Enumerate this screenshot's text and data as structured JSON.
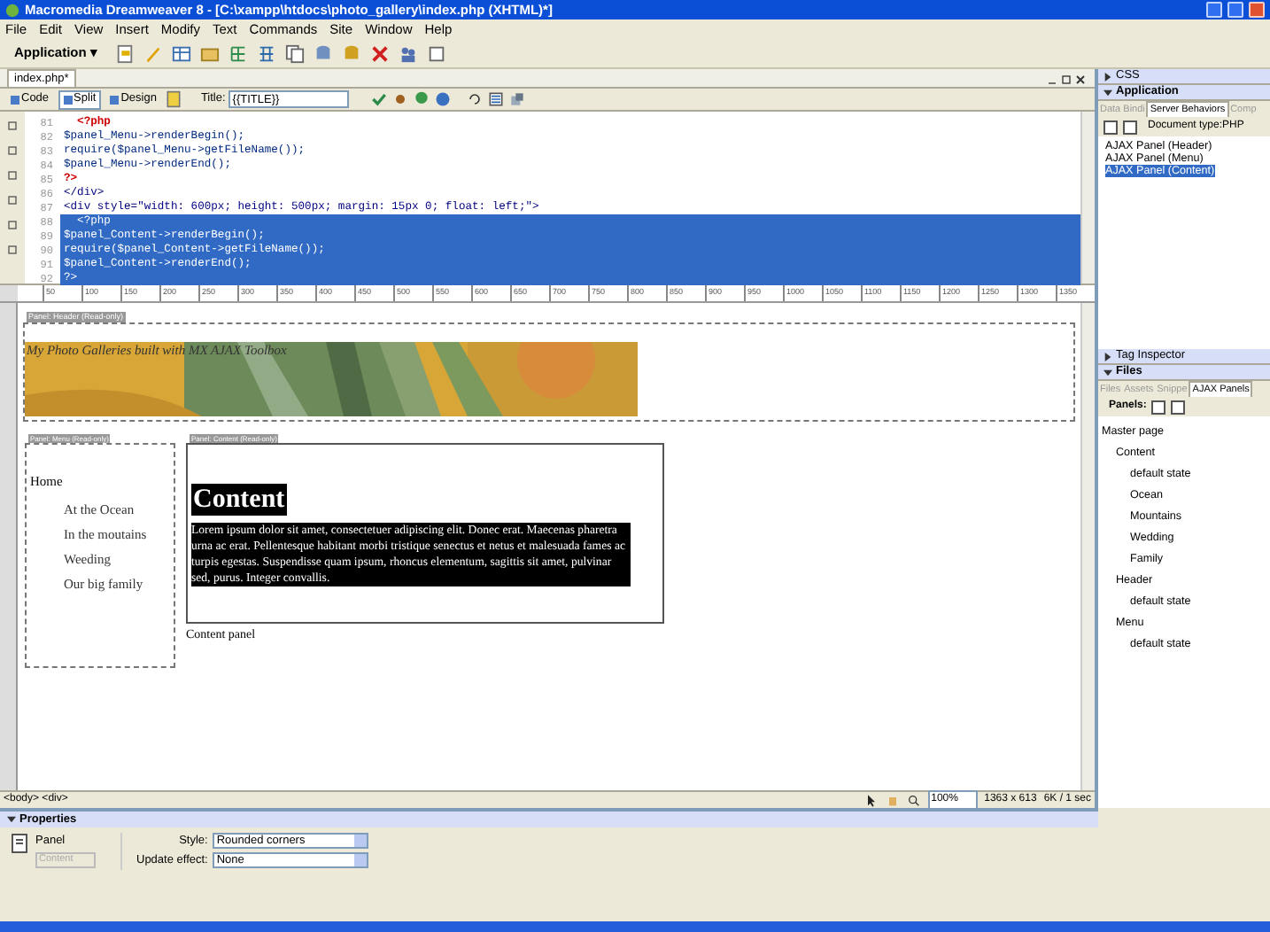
{
  "window": {
    "title": "Macromedia Dreamweaver 8 - [C:\\xampp\\htdocs\\photo_gallery\\index.php (XHTML)*]"
  },
  "menu": [
    "File",
    "Edit",
    "View",
    "Insert",
    "Modify",
    "Text",
    "Commands",
    "Site",
    "Window",
    "Help"
  ],
  "toolbar": {
    "category": "Application ▾"
  },
  "document": {
    "tab": "index.php*",
    "views": [
      {
        "label": "Code",
        "selected": false
      },
      {
        "label": "Split",
        "selected": true
      },
      {
        "label": "Design",
        "selected": false
      }
    ],
    "title_label": "Title:",
    "title_value": "{{TITLE}}",
    "code_lines": [
      {
        "number": "81",
        "text": "  <?php",
        "kind": "php",
        "selected": false
      },
      {
        "number": "82",
        "text": "$panel_Menu->renderBegin();",
        "kind": "code",
        "selected": false
      },
      {
        "number": "83",
        "text": "require($panel_Menu->getFileName());",
        "kind": "code",
        "selected": false
      },
      {
        "number": "84",
        "text": "$panel_Menu->renderEnd();",
        "kind": "code",
        "selected": false
      },
      {
        "number": "85",
        "text": "?>",
        "kind": "php",
        "selected": false
      },
      {
        "number": "86",
        "text": "</div>",
        "kind": "html",
        "selected": false
      },
      {
        "number": "87",
        "text": "<div style=\"width: 600px; height: 500px; margin: 15px 0; float: left;\">",
        "kind": "html",
        "selected": false
      },
      {
        "number": "88",
        "text": "  <?php",
        "kind": "php",
        "selected": true
      },
      {
        "number": "89",
        "text": "$panel_Content->renderBegin();",
        "kind": "code",
        "selected": true
      },
      {
        "number": "90",
        "text": "require($panel_Content->getFileName());",
        "kind": "code",
        "selected": true
      },
      {
        "number": "91",
        "text": "$panel_Content->renderEnd();",
        "kind": "code",
        "selected": true
      },
      {
        "number": "92",
        "text": "?>",
        "kind": "php",
        "selected": true
      }
    ],
    "ruler_labels": [
      "50",
      "100",
      "150",
      "200",
      "250",
      "300",
      "350",
      "400",
      "450",
      "500",
      "550",
      "600",
      "650",
      "700",
      "750",
      "800",
      "850",
      "900",
      "950",
      "1000",
      "1050",
      "1100",
      "1150",
      "1200",
      "1250",
      "1300",
      "1350"
    ],
    "design": {
      "header_tag": "Panel: Header (Read-only)",
      "header_text": "My Photo Galleries built with MX AJAX Toolbox",
      "menu_tag": "Panel: Menu (Read-only)",
      "menu_home": "Home",
      "menu_links": [
        "At the Ocean",
        "In the moutains",
        "Weeding",
        "Our big family"
      ],
      "content_tag": "Panel: Content (Read-only)",
      "content_heading": "Content",
      "content_text": "Lorem ipsum dolor sit amet, consectetuer adipiscing elit. Donec erat. Maecenas pharetra urna ac erat. Pellentesque habitant morbi tristique senectus et netus et malesuada fames ac turpis egestas. Suspendisse quam ipsum, rhoncus elementum, sagittis sit amet, pulvinar sed, purus. Integer convallis.",
      "content_caption": "Content panel"
    },
    "status_bar": {
      "tags": "<body> <div>",
      "zoom": "100%",
      "size": "1363 x 613",
      "download": "6K / 1 sec"
    }
  },
  "panels": [
    {
      "title": "CSS",
      "expanded": false
    },
    {
      "title": "Application",
      "expanded": true,
      "tabs": [
        {
          "label": "Data Bindi",
          "selected": false
        },
        {
          "label": "Server Behaviors",
          "selected": true
        },
        {
          "label": "Comp",
          "selected": false
        }
      ],
      "info": "Document type:PHP",
      "items": [
        {
          "label": "AJAX Panel (Header)",
          "selected": false
        },
        {
          "label": "AJAX Panel (Menu)",
          "selected": false
        },
        {
          "label": "AJAX Panel (Content)",
          "selected": true
        }
      ]
    },
    {
      "title": "Tag Inspector",
      "expanded": false
    },
    {
      "title": "Files",
      "expanded": true,
      "tabs": [
        {
          "label": "Files",
          "selected": false
        },
        {
          "label": "Assets",
          "selected": false
        },
        {
          "label": "Snippe",
          "selected": false
        },
        {
          "label": "AJAX Panels",
          "selected": true
        }
      ],
      "info": "Panels:",
      "tree": [
        {
          "label": "Master page",
          "children": [
            {
              "label": "Content",
              "children": [
                {
                  "label": "default state"
                },
                {
                  "label": "Ocean"
                },
                {
                  "label": "Mountains"
                },
                {
                  "label": "Wedding"
                },
                {
                  "label": "Family"
                }
              ]
            },
            {
              "label": "Header",
              "children": [
                {
                  "label": "default state"
                }
              ]
            },
            {
              "label": "Menu",
              "children": [
                {
                  "label": "default state"
                }
              ]
            }
          ]
        }
      ]
    }
  ],
  "properties": {
    "title": "Properties",
    "element": "Panel",
    "name_value": "Content",
    "style_label": "Style:",
    "style_value": "Rounded corners",
    "effect_label": "Update effect:",
    "effect_value": "None"
  }
}
